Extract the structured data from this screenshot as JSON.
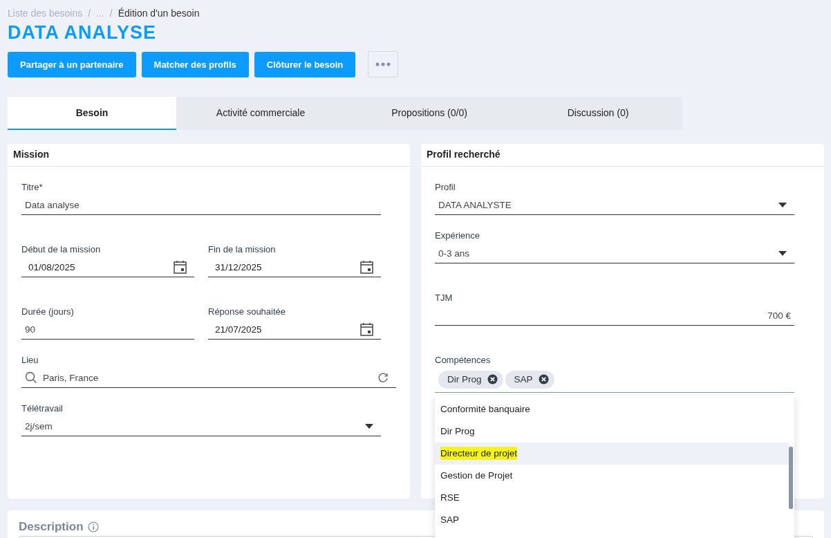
{
  "breadcrumb": [
    "Liste des besoins",
    "...",
    "Édition d'un besoin"
  ],
  "breadcrumb_separator": "/",
  "title": "DATA ANALYSE",
  "actions": [
    "Partager à un partenaire",
    "Matcher des profils",
    "Clôturer le besoin"
  ],
  "tabs": [
    {
      "label": "Besoin",
      "selected": true
    },
    {
      "label": "Activité commerciale",
      "selected": false
    },
    {
      "label": "Propositions (0/0)",
      "selected": false
    },
    {
      "label": "Discussion (0)",
      "selected": false
    }
  ],
  "mission": {
    "title": "Mission",
    "rows": [
      [
        {
          "label": "Titre*",
          "value": "Data analyse",
          "kind": "text"
        }
      ],
      [
        {
          "label": "Début de la mission",
          "value": "01/08/2025",
          "kind": "date"
        },
        {
          "label": "Fin de la mission",
          "value": "31/12/2025",
          "kind": "date"
        }
      ],
      [
        {
          "label": "Durée (jours)",
          "value": "90",
          "kind": "text"
        },
        {
          "label": "Réponse souhaitée",
          "value": "21/07/2025",
          "kind": "date"
        }
      ],
      [
        {
          "label": "Lieu",
          "value": "Paris, France",
          "kind": "search"
        }
      ],
      [
        {
          "label": "Télétravail",
          "value": "2j/sem",
          "kind": "select"
        }
      ]
    ]
  },
  "profile": {
    "title": "Profil recherché",
    "fields": [
      {
        "label": "Profil",
        "value": "DATA ANALYSTE",
        "kind": "select"
      },
      {
        "label": "Expérience",
        "value": "0-3 ans",
        "kind": "select"
      },
      {
        "label": "TJM",
        "value": "700 €",
        "kind": "amount"
      }
    ],
    "skills": {
      "label": "Compétences",
      "tags": [
        "Dir Prog",
        "SAP"
      ],
      "options": [
        {
          "label": "Conformité banquaire",
          "highlighted": false
        },
        {
          "label": "Dir Prog",
          "highlighted": false
        },
        {
          "label": "Directeur de projet",
          "highlighted": true
        },
        {
          "label": "Gestion de Projet",
          "highlighted": false
        },
        {
          "label": "RSE",
          "highlighted": false
        },
        {
          "label": "SAP",
          "highlighted": false
        }
      ]
    }
  },
  "description": {
    "title": "Description"
  }
}
